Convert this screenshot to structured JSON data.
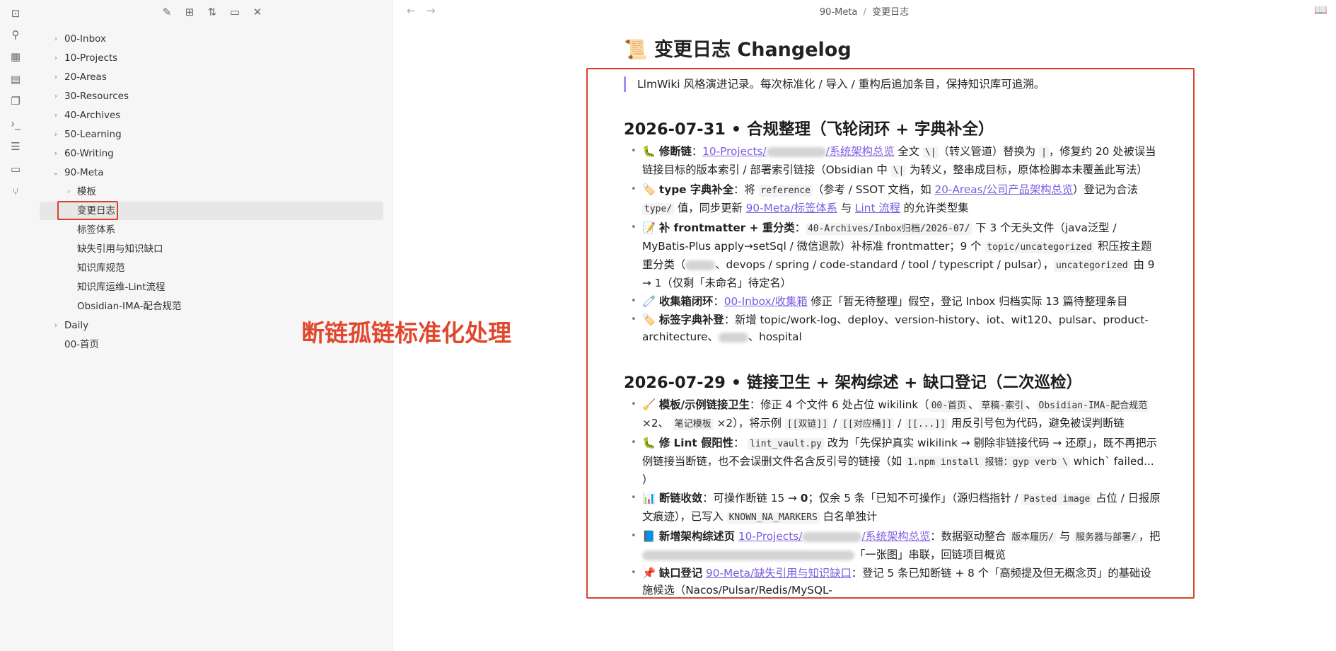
{
  "ribbon": {
    "icons": [
      "vault-icon",
      "graph-icon",
      "canvas-icon",
      "calendar-icon",
      "copy-icon",
      "terminal-icon",
      "outline-icon",
      "layout-icon",
      "git-icon"
    ]
  },
  "sidebar": {
    "tree": [
      {
        "label": "00-Inbox",
        "level": 0,
        "folder": true,
        "open": false
      },
      {
        "label": "10-Projects",
        "level": 0,
        "folder": true,
        "open": false
      },
      {
        "label": "20-Areas",
        "level": 0,
        "folder": true,
        "open": false
      },
      {
        "label": "30-Resources",
        "level": 0,
        "folder": true,
        "open": false
      },
      {
        "label": "40-Archives",
        "level": 0,
        "folder": true,
        "open": false
      },
      {
        "label": "50-Learning",
        "level": 0,
        "folder": true,
        "open": false
      },
      {
        "label": "60-Writing",
        "level": 0,
        "folder": true,
        "open": false
      },
      {
        "label": "90-Meta",
        "level": 0,
        "folder": true,
        "open": true
      },
      {
        "label": "模板",
        "level": 1,
        "folder": true,
        "open": false
      },
      {
        "label": "变更日志",
        "level": 1,
        "folder": false,
        "active": true
      },
      {
        "label": "标签体系",
        "level": 1,
        "folder": false
      },
      {
        "label": "缺失引用与知识缺口",
        "level": 1,
        "folder": false
      },
      {
        "label": "知识库规范",
        "level": 1,
        "folder": false
      },
      {
        "label": "知识库运维-Lint流程",
        "level": 1,
        "folder": false
      },
      {
        "label": "Obsidian-IMA-配合规范",
        "level": 1,
        "folder": false
      },
      {
        "label": "Daily",
        "level": 0,
        "folder": true,
        "open": false
      },
      {
        "label": "00-首页",
        "level": 0,
        "folder": false
      }
    ]
  },
  "annotation": {
    "text": "断链孤链标准化处理",
    "color": "#d9432b"
  },
  "topbar": {
    "breadcrumb_folder": "90-Meta",
    "breadcrumb_sep": "/",
    "breadcrumb_file": "变更日志",
    "back": "←",
    "forward": "→"
  },
  "doc": {
    "title_icon": "📜",
    "title": "变更日志 Changelog",
    "callout": "LlmWiki 风格演进记录。每次标准化 / 导入 / 重构后追加条目，保持知识库可追溯。",
    "s1": {
      "heading": "2026-07-31 • 合规整理（飞轮闭环 + 字典补全）",
      "i1": {
        "icon": "🐛",
        "title": "修断链",
        "p1": "：",
        "link": "10-Projects/",
        "link2": "/系统架构总览",
        "p2": " 全文 ",
        "c1": "\\|",
        "p3": "（转义管道）替换为 ",
        "c2": "|",
        "p4": "，修复约 20 处被误当链接目标的版本索引 / 部署索引链接（Obsidian 中 ",
        "c3": "\\|",
        "p5": " 为转义，整串成目标，原体检脚本未覆盖此写法）"
      },
      "i2": {
        "icon": "🏷️",
        "title": "type 字典补全",
        "p1": "：将 ",
        "c1": "reference",
        "p2": "（参考 / SSOT 文档，如 ",
        "link": "20-Areas/公司产品架构总览",
        "p3": "）登记为合法 ",
        "c2": "type/",
        "p4": " 值，同步更新 ",
        "link2": "90-Meta/标签体系",
        "p5": " 与 ",
        "link3": "Lint 流程",
        "p6": " 的允许类型集"
      },
      "i3": {
        "icon": "📝",
        "title": "补 frontmatter + 重分类",
        "p1": "：",
        "c1": "40-Archives/Inbox归档/2026-07/",
        "p2": " 下 3 个无头文件（java泛型 / MyBatis-Plus apply→setSql / 微信退款）补标准 frontmatter；9 个 ",
        "c2": "topic/uncategorized",
        "p3": " 积压按主题重分类（",
        "p4": "、devops / spring / code-standard / tool / typescript / pulsar），",
        "c3": "uncategorized",
        "p5": " 由 9 → 1（仅剩「未命名」待定名）"
      },
      "i4": {
        "icon": "🧷",
        "title": "收集箱闭环",
        "p1": "：",
        "link": "00-Inbox/收集箱",
        "p2": " 修正「暂无待整理」假空，登记 Inbox 归档实际 13 篇待整理条目"
      },
      "i5": {
        "icon": "🏷️",
        "title": "标签字典补登",
        "p1": "：新增 topic/work-log、deploy、version-history、iot、wit120、pulsar、product-architecture、",
        "p2": "、hospital"
      }
    },
    "s2": {
      "heading": "2026-07-29 • 链接卫生 + 架构综述 + 缺口登记（二次巡检）",
      "i1": {
        "icon": "🧹",
        "title": "模板/示例链接卫生",
        "p1": "：修正 4 个文件 6 处占位 wikilink（",
        "c1": "00-首页",
        "p2": "、",
        "c2": "草稿-索引",
        "p3": "、",
        "c3": "Obsidian-IMA-配合规范",
        "p4": " ×2、 ",
        "c4": "笔记模板",
        "p5": " ×2），将示例 ",
        "c5": "[[双链]]",
        "p6": " / ",
        "c6": "[[对应桶]]",
        "p7": " / ",
        "c7": "[[...]]",
        "p8": " 用反引号包为代码，避免被误判断链"
      },
      "i2": {
        "icon": "🐛",
        "title": "修 Lint 假阳性",
        "p1": "： ",
        "c1": "lint_vault.py",
        "p2": " 改为「先保护真实 wikilink → 剔除非链接代码 → 还原」，既不再把示例链接当断链，也不会误删文件名含反引号的链接（如 ",
        "c2": "1.npm install 报错：gyp verb \\",
        "p3": " which` failed... ）"
      },
      "i3": {
        "icon": "📊",
        "title": "断链收敛",
        "p1": "：可操作断链 15 → ",
        "b1": "0",
        "p2": "；仅余 5 条「已知不可操作」（源归档指针 / ",
        "c1": "Pasted image",
        "p3": " 占位 / 日报原文痕迹），已写入 ",
        "c2": "KNOWN_NA_MARKERS",
        "p4": " 白名单独计"
      },
      "i4": {
        "icon": "📘",
        "title": "新增架构综述页",
        "p1": " ",
        "link": "10-Projects/",
        "link2": "/系统架构总览",
        "p2": "：数据驱动整合 ",
        "c1": "版本履历/",
        "p3": " 与 ",
        "c2": "服务器与部署/",
        "p4": "，把",
        "p5": "「一张图」串联，回链项目概览"
      },
      "i5": {
        "icon": "📌",
        "title": "缺口登记",
        "p1": " ",
        "link": "90-Meta/缺失引用与知识缺口",
        "p2": "：登记 5 条已知断链 + 8 个「高频提及但无概念页」的基础设施候选（Nacos/Pulsar/Redis/MySQL-"
      }
    }
  }
}
